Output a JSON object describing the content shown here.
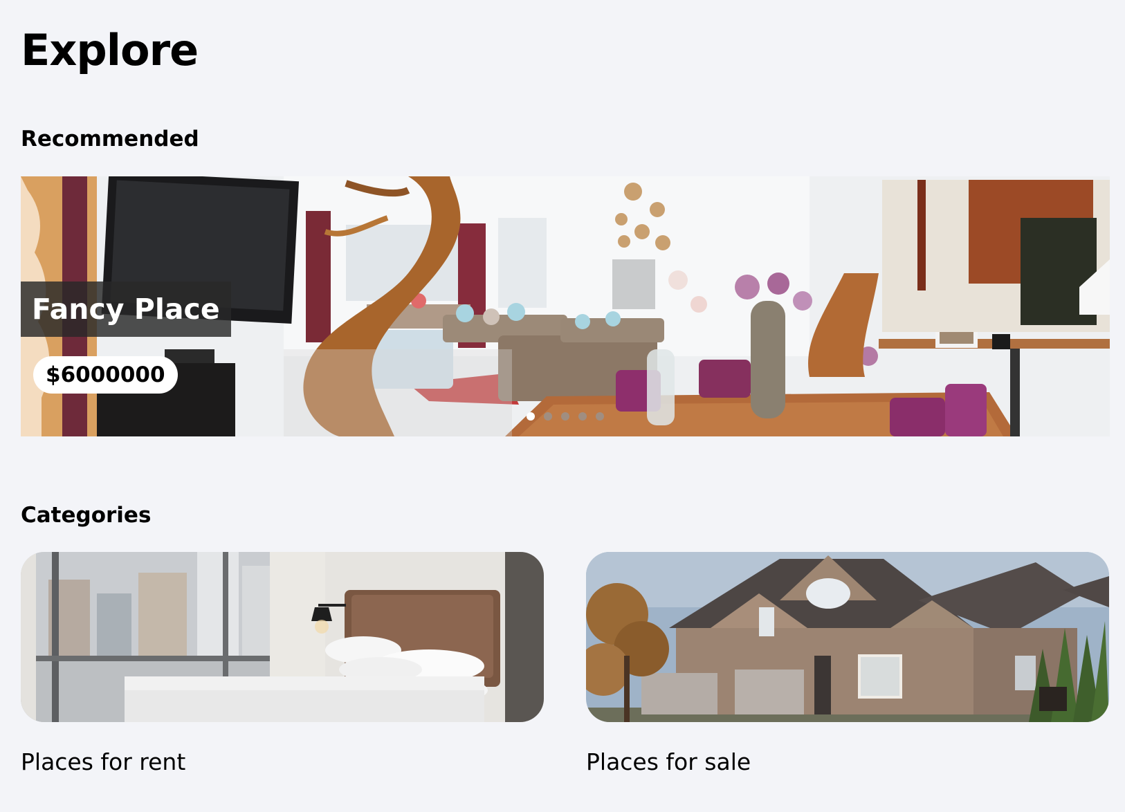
{
  "page": {
    "title": "Explore"
  },
  "recommended": {
    "heading": "Recommended",
    "featured": {
      "title": "Fancy Place",
      "price": "$6000000"
    },
    "slide_count": 5,
    "active_slide": 1
  },
  "categories": {
    "heading": "Categories",
    "items": [
      {
        "label": "Places for rent"
      },
      {
        "label": "Places for sale"
      }
    ]
  },
  "colors": {
    "background": "#f3f4f8",
    "text": "#000000",
    "title_overlay": "#282828",
    "badge_background": "#ffffff"
  }
}
